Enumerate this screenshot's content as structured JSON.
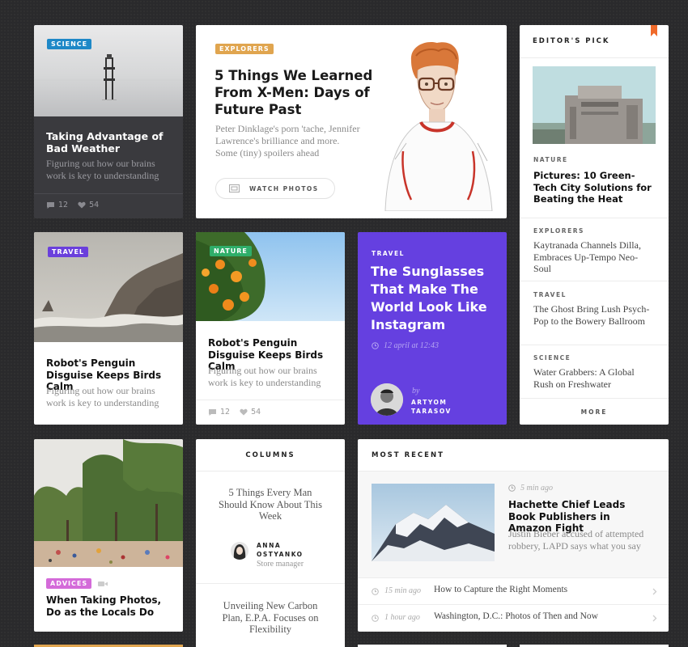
{
  "colors": {
    "science": "#1e88c7",
    "explorers": "#e0a54f",
    "travel": "#6a3fdc",
    "nature": "#2fae6a",
    "advices": "#d46bd9",
    "bookmark": "#f06a2a",
    "purple_card": "#6540e0",
    "dark_card": "#3a3a3e"
  },
  "card1": {
    "tag": "SCIENCE",
    "title": "Taking Advantage of Bad Weather",
    "excerpt": "Figuring out how our brains work is key to understanding",
    "comments": "12",
    "likes": "54",
    "comment_icon": "comment-icon",
    "like_icon": "heart-icon"
  },
  "feature": {
    "tag": "EXPLORERS",
    "title": "5 Things We Learned From X-Men: Days of Future Past",
    "excerpt": "Peter Dinklage's porn 'tache, Jennifer Lawrence's brilliance and more. Some (tiny) spoilers ahead",
    "button_label": "WATCH PHOTOS",
    "button_icon": "photo-icon"
  },
  "editors_pick": {
    "heading": "EDITOR'S PICK",
    "bookmark_icon": "bookmark-icon",
    "main": {
      "category": "NATURE",
      "title": "Pictures: 10 Green-Tech City Solutions for Beating the Heat"
    },
    "items": [
      {
        "category": "EXPLORERS",
        "title": "Kaytranada Channels Dilla, Embraces Up-Tempo Neo-Soul"
      },
      {
        "category": "TRAVEL",
        "title": "The Ghost Bring Lush Psych-Pop to the Bowery Ballroom"
      },
      {
        "category": "SCIENCE",
        "title": "Water Grabbers: A Global Rush on Freshwater"
      }
    ],
    "more_label": "MORE"
  },
  "card_travel": {
    "tag": "TRAVEL",
    "title": "Robot's Penguin Disguise Keeps Birds Calm",
    "excerpt": "Figuring out how our brains work is key to understanding"
  },
  "card_nature": {
    "tag": "NATURE",
    "title": "Robot's Penguin Disguise Keeps Birds Calm",
    "excerpt": "Figuring out how our brains work is key to understanding",
    "comments": "12",
    "likes": "54"
  },
  "purple": {
    "tag": "TRAVEL",
    "title": "The Sunglasses That Make The World Look Like Instagram",
    "date": "12 april at 12:43",
    "clock_icon": "clock-icon",
    "by": "by",
    "author_first": "ARTYOM",
    "author_last": "TARASOV"
  },
  "card_advices": {
    "tag": "ADVICES",
    "video_icon": "video-camera-icon",
    "title": "When Taking Photos, Do as the Locals Do"
  },
  "columns": {
    "heading": "COLUMNS",
    "entry1": "5 Things Every Man Should Know About This Week",
    "author_first": "ANNA",
    "author_last": "OSTYANKO",
    "author_role": "Store manager",
    "entry2": "Unveiling New Carbon Plan, E.P.A. Focuses on Flexibility"
  },
  "most_recent": {
    "heading": "MOST RECENT",
    "featured": {
      "time": "5 min ago",
      "title": "Hachette Chief Leads Book Publishers in Amazon Fight",
      "excerpt": "Justin Bieber accused of attempted robbery, LAPD says what you say"
    },
    "list": [
      {
        "time": "15 min ago",
        "title": "How to Capture the Right Moments"
      },
      {
        "time": "1 hour ago",
        "title": "Washington, D.C.: Photos of Then and Now"
      }
    ],
    "chevron_icon": "chevron-right-icon"
  }
}
